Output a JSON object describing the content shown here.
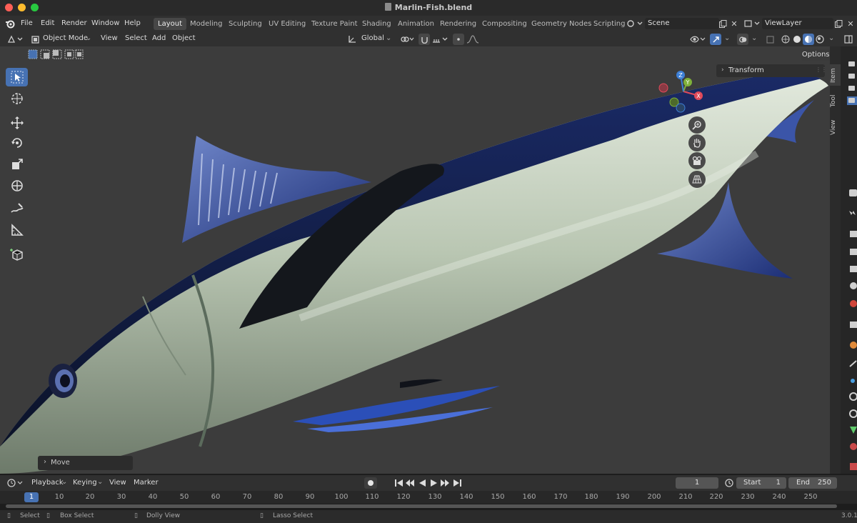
{
  "window": {
    "title": "Marlin-Fish.blend"
  },
  "menu": [
    "File",
    "Edit",
    "Render",
    "Window",
    "Help"
  ],
  "workspaces": [
    "Layout",
    "Modeling",
    "Sculpting",
    "UV Editing",
    "Texture Paint",
    "Shading",
    "Animation",
    "Rendering",
    "Compositing",
    "Geometry Nodes",
    "Scripting"
  ],
  "active_workspace": "Layout",
  "scene_name": "Scene",
  "view_layer": "ViewLayer",
  "viewport_header": {
    "mode": "Object Mode",
    "menus": [
      "View",
      "Select",
      "Add",
      "Object"
    ],
    "orientation": "Global",
    "options_label": "Options"
  },
  "npanel": {
    "transform_label": "Transform",
    "tabs": [
      "Item",
      "Tool",
      "View"
    ]
  },
  "gizmo": {
    "x": "X",
    "y": "Y",
    "z": "Z"
  },
  "last_operator": "Move",
  "timeline": {
    "menus": [
      "Playback",
      "Keying",
      "View",
      "Marker"
    ],
    "current_frame": "1",
    "start_label": "Start",
    "start": "1",
    "end_label": "End",
    "end": "250",
    "ruler_ticks": [
      "1",
      "10",
      "20",
      "30",
      "40",
      "50",
      "60",
      "70",
      "80",
      "90",
      "100",
      "110",
      "120",
      "130",
      "140",
      "150",
      "160",
      "170",
      "180",
      "190",
      "200",
      "210",
      "220",
      "230",
      "240",
      "250"
    ]
  },
  "statusbar": {
    "select": "Select",
    "box_select": "Box Select",
    "dolly_view": "Dolly View",
    "lasso_select": "Lasso Select",
    "version": "3.0.1"
  },
  "colors": {
    "accent": "#4772b3",
    "viewport_bg": "#3c3c3c",
    "axis_x": "#e04a5a",
    "axis_y": "#7fb13a",
    "axis_z": "#3d7fd6"
  }
}
